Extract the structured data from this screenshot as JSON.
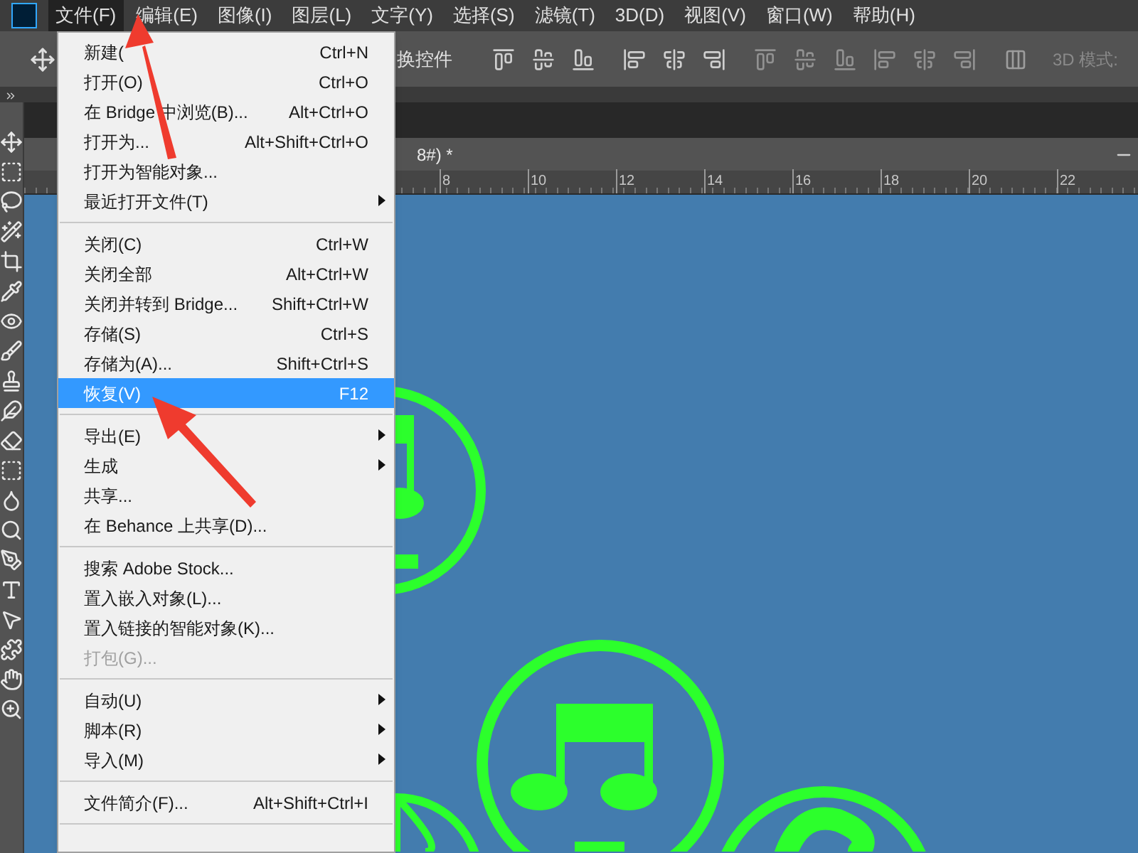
{
  "menubar": {
    "items": [
      {
        "label": "文件(F)",
        "selected": true
      },
      {
        "label": "编辑(E)",
        "selected": false
      },
      {
        "label": "图像(I)",
        "selected": false
      },
      {
        "label": "图层(L)",
        "selected": false
      },
      {
        "label": "文字(Y)",
        "selected": false
      },
      {
        "label": "选择(S)",
        "selected": false
      },
      {
        "label": "滤镜(T)",
        "selected": false
      },
      {
        "label": "3D(D)",
        "selected": false
      },
      {
        "label": "视图(V)",
        "selected": false
      },
      {
        "label": "窗口(W)",
        "selected": false
      },
      {
        "label": "帮助(H)",
        "selected": false
      }
    ]
  },
  "options_bar": {
    "label_1": "换控件",
    "label_2": "3D 模式:"
  },
  "document": {
    "tab_title": "8#) *",
    "ruler_labels": [
      "8",
      "10",
      "12",
      "14",
      "16",
      "18",
      "20",
      "22"
    ]
  },
  "file_menu": {
    "items": [
      {
        "kind": "item",
        "label": "新建(",
        "shortcut": "Ctrl+N",
        "submenu": false,
        "disabled": false,
        "selected": false
      },
      {
        "kind": "item",
        "label": "打开(O)",
        "shortcut": "Ctrl+O",
        "submenu": false,
        "disabled": false,
        "selected": false
      },
      {
        "kind": "item",
        "label": "在 Bridge 中浏览(B)...",
        "shortcut": "Alt+Ctrl+O",
        "submenu": false,
        "disabled": false,
        "selected": false
      },
      {
        "kind": "item",
        "label": "打开为...",
        "shortcut": "Alt+Shift+Ctrl+O",
        "submenu": false,
        "disabled": false,
        "selected": false
      },
      {
        "kind": "item",
        "label": "打开为智能对象...",
        "submenu": false,
        "disabled": false,
        "selected": false
      },
      {
        "kind": "item",
        "label": "最近打开文件(T)",
        "submenu": true,
        "disabled": false,
        "selected": false
      },
      {
        "kind": "separator"
      },
      {
        "kind": "item",
        "label": "关闭(C)",
        "shortcut": "Ctrl+W",
        "submenu": false,
        "disabled": false,
        "selected": false
      },
      {
        "kind": "item",
        "label": "关闭全部",
        "shortcut": "Alt+Ctrl+W",
        "submenu": false,
        "disabled": false,
        "selected": false
      },
      {
        "kind": "item",
        "label": "关闭并转到 Bridge...",
        "shortcut": "Shift+Ctrl+W",
        "submenu": false,
        "disabled": false,
        "selected": false
      },
      {
        "kind": "item",
        "label": "存储(S)",
        "shortcut": "Ctrl+S",
        "submenu": false,
        "disabled": false,
        "selected": false
      },
      {
        "kind": "item",
        "label": "存储为(A)...",
        "shortcut": "Shift+Ctrl+S",
        "submenu": false,
        "disabled": false,
        "selected": false
      },
      {
        "kind": "item",
        "label": "恢复(V)",
        "shortcut": "F12",
        "submenu": false,
        "disabled": false,
        "selected": true
      },
      {
        "kind": "separator"
      },
      {
        "kind": "item",
        "label": "导出(E)",
        "submenu": true,
        "disabled": false,
        "selected": false
      },
      {
        "kind": "item",
        "label": "生成",
        "submenu": true,
        "disabled": false,
        "selected": false
      },
      {
        "kind": "item",
        "label": "共享...",
        "submenu": false,
        "disabled": false,
        "selected": false
      },
      {
        "kind": "item",
        "label": "在 Behance 上共享(D)...",
        "submenu": false,
        "disabled": false,
        "selected": false
      },
      {
        "kind": "separator"
      },
      {
        "kind": "item",
        "label": "搜索 Adobe Stock...",
        "submenu": false,
        "disabled": false,
        "selected": false
      },
      {
        "kind": "item",
        "label": "置入嵌入对象(L)...",
        "submenu": false,
        "disabled": false,
        "selected": false
      },
      {
        "kind": "item",
        "label": "置入链接的智能对象(K)...",
        "submenu": false,
        "disabled": false,
        "selected": false
      },
      {
        "kind": "item",
        "label": "打包(G)...",
        "submenu": false,
        "disabled": true,
        "selected": false
      },
      {
        "kind": "separator"
      },
      {
        "kind": "item",
        "label": "自动(U)",
        "submenu": true,
        "disabled": false,
        "selected": false
      },
      {
        "kind": "item",
        "label": "脚本(R)",
        "submenu": true,
        "disabled": false,
        "selected": false
      },
      {
        "kind": "item",
        "label": "导入(M)",
        "submenu": true,
        "disabled": false,
        "selected": false
      },
      {
        "kind": "separator"
      },
      {
        "kind": "item",
        "label": "文件简介(F)...",
        "shortcut": "Alt+Shift+Ctrl+I",
        "submenu": false,
        "disabled": false,
        "selected": false
      },
      {
        "kind": "separator"
      }
    ]
  }
}
